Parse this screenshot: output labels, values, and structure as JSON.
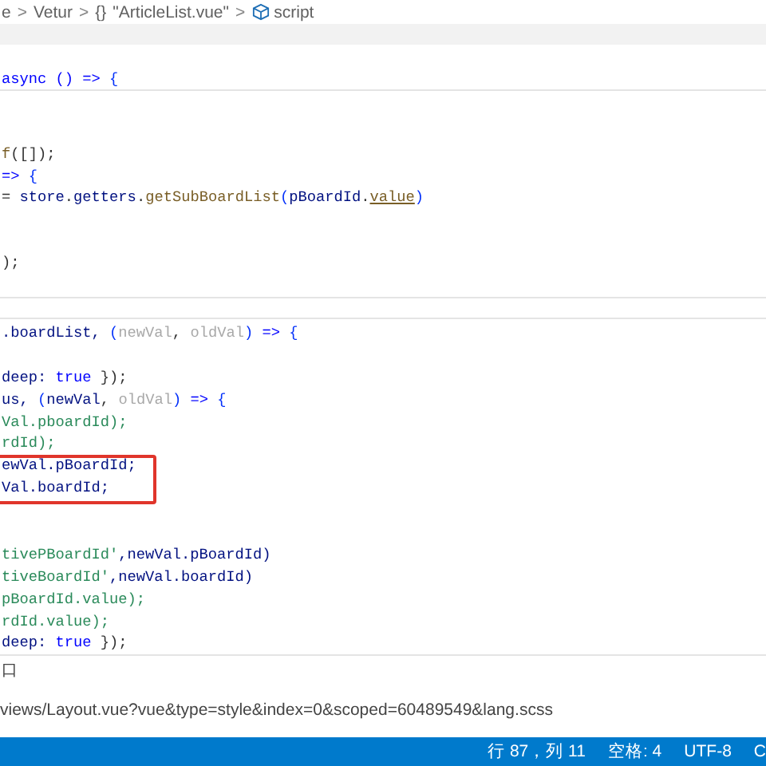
{
  "breadcrumb": [
    {
      "text": "e",
      "kind": "text"
    },
    {
      "text": ">",
      "kind": "sep"
    },
    {
      "text": "Vetur",
      "kind": "text"
    },
    {
      "text": ">",
      "kind": "sep"
    },
    {
      "text": "{}",
      "kind": "glyph"
    },
    {
      "text": "\"ArticleList.vue\"",
      "kind": "text"
    },
    {
      "text": ">",
      "kind": "sep"
    },
    {
      "text": "script",
      "kind": "cube"
    }
  ],
  "sticky_header": {
    "lines": [
      {
        "kind": "code",
        "tokens": [
          {
            "text": "async () =>",
            "kind": "kw"
          },
          {
            "text": " {",
            "kind": "brace"
          }
        ]
      }
    ]
  },
  "code_top": {
    "lines": [
      {
        "kind": "blank"
      },
      {
        "kind": "blank"
      },
      {
        "kind": "code",
        "tokens": [
          {
            "text": "f",
            "kind": "fn"
          },
          {
            "text": "([]);",
            "kind": "punc"
          }
        ]
      },
      {
        "kind": "code",
        "tokens": [
          {
            "text": "=>",
            "kind": "kw"
          },
          {
            "text": " {",
            "kind": "brace"
          }
        ]
      },
      {
        "kind": "code",
        "tokens": [
          {
            "text": "= ",
            "kind": "punc"
          },
          {
            "text": "store",
            "kind": "var"
          },
          {
            "text": ".",
            "kind": "punc"
          },
          {
            "text": "getters",
            "kind": "var"
          },
          {
            "text": ".",
            "kind": "punc"
          },
          {
            "text": "getSubBoardList",
            "kind": "fn"
          },
          {
            "text": "(",
            "kind": "brace"
          },
          {
            "text": "pBoardId",
            "kind": "var"
          },
          {
            "text": ".",
            "kind": "punc"
          },
          {
            "text": "value",
            "kind": "underlined"
          },
          {
            "text": ")",
            "kind": "brace"
          }
        ]
      },
      {
        "kind": "blank"
      },
      {
        "kind": "blank"
      },
      {
        "kind": "code",
        "tokens": [
          {
            "text": ");",
            "kind": "punc"
          }
        ]
      }
    ]
  },
  "code_bottom": {
    "lines": [
      {
        "kind": "code",
        "tokens": [
          {
            "text": ".boardList, ",
            "kind": "var"
          },
          {
            "text": "(",
            "kind": "brace"
          },
          {
            "text": "newVal",
            "kind": "param"
          },
          {
            "text": ", ",
            "kind": "punc"
          },
          {
            "text": "oldVal",
            "kind": "param"
          },
          {
            "text": ")",
            "kind": "brace"
          },
          {
            "text": " =>",
            "kind": "kw"
          },
          {
            "text": " {",
            "kind": "brace"
          }
        ]
      },
      {
        "kind": "blank"
      },
      {
        "kind": "code",
        "tokens": [
          {
            "text": "deep: ",
            "kind": "var"
          },
          {
            "text": "true",
            "kind": "kw"
          },
          {
            "text": " });",
            "kind": "punc"
          }
        ]
      },
      {
        "kind": "code",
        "tokens": [
          {
            "text": "us, ",
            "kind": "var"
          },
          {
            "text": "(",
            "kind": "brace"
          },
          {
            "text": "newVal",
            "kind": "var"
          },
          {
            "text": ", ",
            "kind": "punc"
          },
          {
            "text": "oldVal",
            "kind": "param"
          },
          {
            "text": ")",
            "kind": "brace"
          },
          {
            "text": " =>",
            "kind": "kw"
          },
          {
            "text": " {",
            "kind": "brace"
          }
        ]
      },
      {
        "kind": "code",
        "tokens": [
          {
            "text": "Val.pboardId);",
            "kind": "green"
          }
        ]
      },
      {
        "kind": "code",
        "tokens": [
          {
            "text": "rdId);",
            "kind": "green"
          }
        ]
      },
      {
        "kind": "code",
        "tokens": [
          {
            "text": "ewVal.pBoardId;",
            "kind": "var"
          }
        ]
      },
      {
        "kind": "code",
        "tokens": [
          {
            "text": "Val.boardId;",
            "kind": "var"
          }
        ]
      },
      {
        "kind": "blank"
      },
      {
        "kind": "blank"
      },
      {
        "kind": "code",
        "tokens": [
          {
            "text": "tivePBoardId'",
            "kind": "green"
          },
          {
            "text": ",newVal.pBoardId)",
            "kind": "var"
          }
        ]
      },
      {
        "kind": "code",
        "tokens": [
          {
            "text": "tiveBoardId'",
            "kind": "green"
          },
          {
            "text": ",newVal.boardId)",
            "kind": "var"
          }
        ]
      },
      {
        "kind": "code",
        "tokens": [
          {
            "text": "pBoardId.value);",
            "kind": "green"
          }
        ]
      },
      {
        "kind": "code",
        "tokens": [
          {
            "text": "rdId.value);",
            "kind": "green"
          }
        ]
      },
      {
        "kind": "code",
        "tokens": [
          {
            "text": "deep: ",
            "kind": "var"
          },
          {
            "text": "true",
            "kind": "kw"
          },
          {
            "text": " });",
            "kind": "punc"
          }
        ]
      }
    ]
  },
  "panel": {
    "title": "口",
    "output": "views/Layout.vue?vue&type=style&index=0&scoped=60489549&lang.scss"
  },
  "status_bar": [
    {
      "text": "行 87，列 11"
    },
    {
      "text": "空格: 4"
    },
    {
      "text": "UTF-8"
    },
    {
      "text": "C"
    }
  ]
}
